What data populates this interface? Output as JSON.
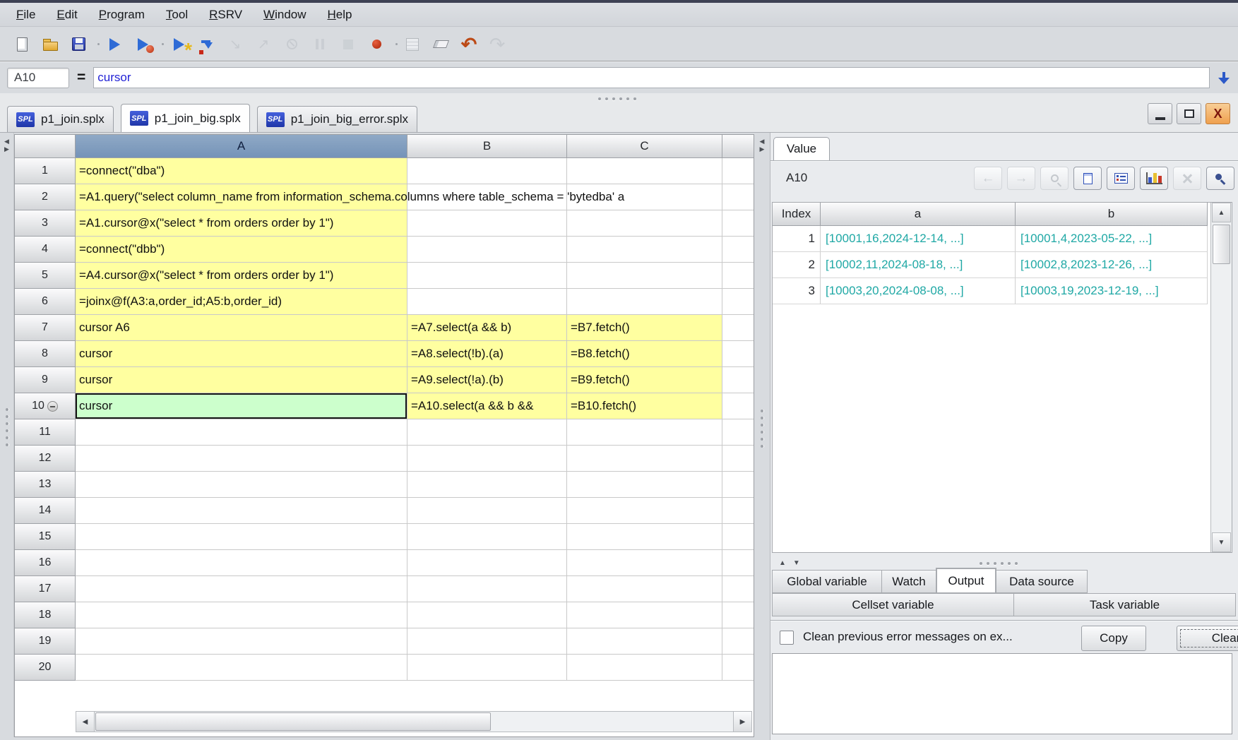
{
  "menu_bar": {
    "items": [
      "File",
      "Edit",
      "Program",
      "Tool",
      "RSRV",
      "Window",
      "Help"
    ]
  },
  "main_toolbar": {
    "icons": [
      {
        "name": "new-file"
      },
      {
        "name": "open-file"
      },
      {
        "name": "save"
      },
      {
        "name": "run"
      },
      {
        "name": "execute"
      },
      {
        "name": "step-execute"
      },
      {
        "name": "execute-current-cell"
      },
      {
        "name": "step-into",
        "disabled": true
      },
      {
        "name": "step-return",
        "disabled": true
      },
      {
        "name": "interrupt",
        "disabled": true
      },
      {
        "name": "pause",
        "disabled": true
      },
      {
        "name": "stop",
        "disabled": true
      },
      {
        "name": "breakpoint"
      },
      {
        "name": "calculator",
        "disabled": true
      },
      {
        "name": "eraser"
      },
      {
        "name": "undo"
      },
      {
        "name": "redo",
        "disabled": true
      }
    ]
  },
  "formula_bar": {
    "cell_ref": "A10",
    "equals": "=",
    "value": "cursor"
  },
  "file_tabs": [
    {
      "badge": "SPL",
      "label": "p1_join.splx",
      "active": false
    },
    {
      "badge": "SPL",
      "label": "p1_join_big.splx",
      "active": true
    },
    {
      "badge": "SPL",
      "label": "p1_join_big_error.splx",
      "active": false
    }
  ],
  "window_controls": [
    "minimize",
    "restore",
    "close"
  ],
  "grid": {
    "columns": [
      "A",
      "B",
      "C"
    ],
    "selected_column": "A",
    "selected_cell": "A10",
    "rows": [
      {
        "n": 1,
        "cells": {
          "A": "=connect(\"dba\")"
        },
        "bg": {
          "A": "yellow"
        }
      },
      {
        "n": 2,
        "cells": {
          "A": "=A1.query(\"select column_name from information_schema.columns where table_schema = 'bytedba' a"
        },
        "bg": {
          "A": "yellow"
        },
        "overflow": true
      },
      {
        "n": 3,
        "cells": {
          "A": "=A1.cursor@x(\"select * from orders order by 1\")"
        },
        "bg": {
          "A": "yellow"
        }
      },
      {
        "n": 4,
        "cells": {
          "A": "=connect(\"dbb\")"
        },
        "bg": {
          "A": "yellow"
        }
      },
      {
        "n": 5,
        "cells": {
          "A": "=A4.cursor@x(\"select * from orders order by 1\")"
        },
        "bg": {
          "A": "yellow"
        }
      },
      {
        "n": 6,
        "cells": {
          "A": "=joinx@f(A3:a,order_id;A5:b,order_id)"
        },
        "bg": {
          "A": "yellow"
        }
      },
      {
        "n": 7,
        "cells": {
          "A": "cursor A6",
          "B": "=A7.select(a && b)",
          "C": "=B7.fetch()"
        },
        "bg": {
          "A": "yellow",
          "B": "yellow",
          "C": "yellow"
        }
      },
      {
        "n": 8,
        "cells": {
          "A": "cursor",
          "B": "=A8.select(!b).(a)",
          "C": "=B8.fetch()"
        },
        "bg": {
          "A": "yellow",
          "B": "yellow",
          "C": "yellow"
        }
      },
      {
        "n": 9,
        "cells": {
          "A": "cursor",
          "B": "=A9.select(!a).(b)",
          "C": "=B9.fetch()"
        },
        "bg": {
          "A": "yellow",
          "B": "yellow",
          "C": "yellow"
        }
      },
      {
        "n": 10,
        "cells": {
          "A": "cursor",
          "B": "=A10.select(a && b &&",
          "C": "=B10.fetch()"
        },
        "bg": {
          "A": "green",
          "B": "yellow",
          "C": "yellow"
        },
        "selected": "A",
        "marker": true
      },
      {
        "n": 11
      },
      {
        "n": 12
      },
      {
        "n": 13
      },
      {
        "n": 14
      },
      {
        "n": 15
      },
      {
        "n": 16
      },
      {
        "n": 17
      },
      {
        "n": 18
      },
      {
        "n": 19
      },
      {
        "n": 20
      }
    ]
  },
  "value_panel": {
    "tab_label": "Value",
    "cell_ref": "A10",
    "toolbar": [
      {
        "name": "back",
        "disabled": true
      },
      {
        "name": "forward",
        "disabled": true
      },
      {
        "name": "preview",
        "disabled": true
      },
      {
        "name": "copy"
      },
      {
        "name": "form-view"
      },
      {
        "name": "chart"
      },
      {
        "name": "edit-tool",
        "disabled": true
      },
      {
        "name": "pin"
      }
    ],
    "table": {
      "headers": [
        "Index",
        "a",
        "b"
      ],
      "rows": [
        {
          "index": 1,
          "a": "[10001,16,2024-12-14, ...]",
          "b": "[10001,4,2023-05-22, ...]"
        },
        {
          "index": 2,
          "a": "[10002,11,2024-08-18, ...]",
          "b": "[10002,8,2023-12-26, ...]"
        },
        {
          "index": 3,
          "a": "[10003,20,2024-08-08, ...]",
          "b": "[10003,19,2023-12-19, ...]"
        }
      ]
    }
  },
  "bottom_panel": {
    "tabs_row1": [
      {
        "label": "Global variable",
        "active": false
      },
      {
        "label": "Watch",
        "active": false
      },
      {
        "label": "Output",
        "active": true
      },
      {
        "label": "Data source",
        "active": false
      }
    ],
    "tabs_row2": [
      {
        "label": "Cellset variable",
        "active": false
      },
      {
        "label": "Task variable",
        "active": false
      }
    ],
    "checkbox_label": "Clean previous error messages on ex...",
    "checkbox_checked": false,
    "copy_label": "Copy",
    "clear_label": "Clear"
  },
  "colors": {
    "cell_yellow": "#FFFFA0",
    "cell_selected_green": "#CCFFCC",
    "value_text_teal": "#1FA8A5",
    "badge_blue": "#2947C5",
    "formula_text_blue": "#2323D6",
    "close_button_orange": "#EFA04E",
    "selected_column_header": "#7E9BBF"
  }
}
